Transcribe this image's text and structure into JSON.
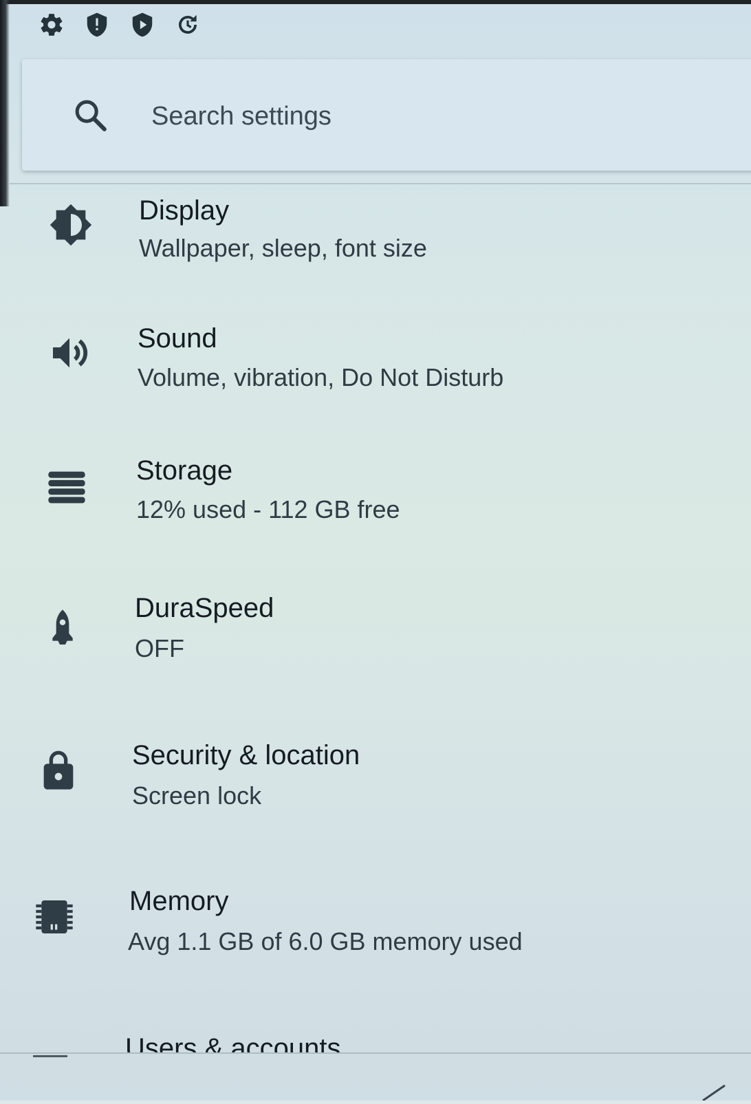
{
  "status_bar": {
    "icons": [
      "settings-gear-icon",
      "shield-alert-icon",
      "play-protect-icon",
      "sync-refresh-icon"
    ]
  },
  "search": {
    "placeholder": "Search settings",
    "icon": "search-icon"
  },
  "settings": [
    {
      "key": "display",
      "title": "Display",
      "subtitle": "Wallpaper, sleep, font size",
      "icon": "brightness-icon"
    },
    {
      "key": "sound",
      "title": "Sound",
      "subtitle": "Volume, vibration, Do Not Disturb",
      "icon": "volume-icon"
    },
    {
      "key": "storage",
      "title": "Storage",
      "subtitle": "12% used - 112 GB free",
      "icon": "storage-icon"
    },
    {
      "key": "duraspeed",
      "title": "DuraSpeed",
      "subtitle": "OFF",
      "icon": "rocket-icon"
    },
    {
      "key": "security",
      "title": "Security & location",
      "subtitle": "Screen lock",
      "icon": "lock-icon"
    },
    {
      "key": "memory",
      "title": "Memory",
      "subtitle": "Avg 1.1 GB of 6.0 GB memory used",
      "icon": "memory-chip-icon"
    },
    {
      "key": "users",
      "title": "Users & accounts",
      "subtitle": "",
      "icon": ""
    }
  ],
  "colors": {
    "icon": "#2f3d46",
    "title_text": "#141c22",
    "subtitle_text": "#2f3c44"
  }
}
